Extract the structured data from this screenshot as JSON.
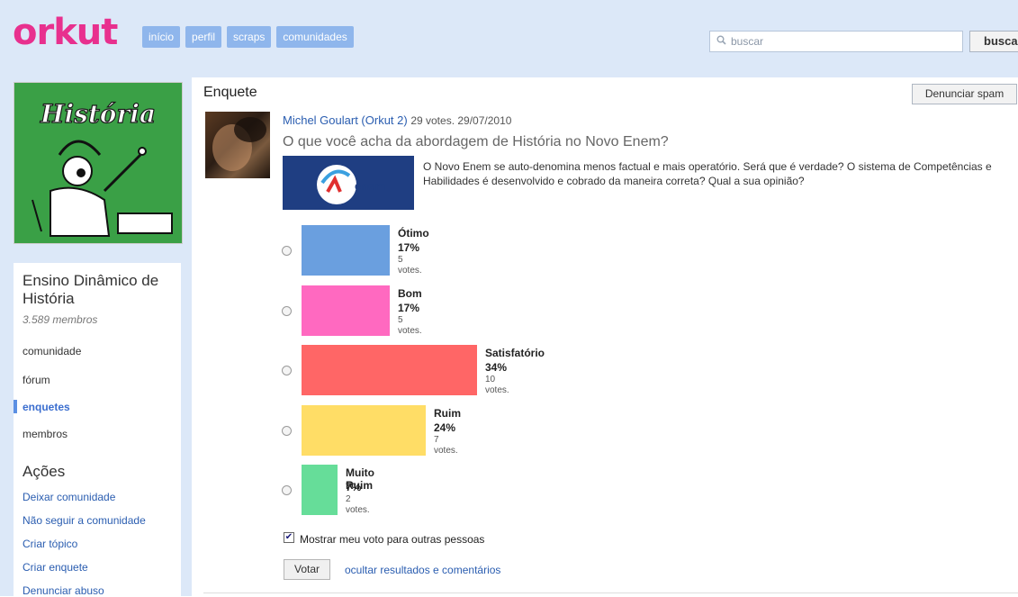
{
  "header": {
    "logo": "orkut",
    "nav": [
      "início",
      "perfil",
      "scraps",
      "comunidades"
    ],
    "search_placeholder": "buscar",
    "search_button": "buscar"
  },
  "sidebar": {
    "community_name": "Ensino Dinâmico de História",
    "members": "3.589 membros",
    "image_title": "História",
    "menu": [
      "comunidade",
      "fórum",
      "enquetes",
      "membros"
    ],
    "active_menu": "enquetes",
    "actions_title": "Ações",
    "actions": [
      "Deixar comunidade",
      "Não seguir a comunidade",
      "Criar tópico",
      "Criar enquete",
      "Denunciar abuso"
    ]
  },
  "poll": {
    "section_title": "Enquete",
    "spam_button": "Denunciar spam",
    "author": "Michel Goulart (Orkut 2)",
    "meta": "29 votes. 29/07/2010",
    "question": "O que você acha da abordagem de História no Novo Enem?",
    "image_label": "enem",
    "description": "O Novo Enem se auto-denomina menos factual e mais operatório. Será que é verdade? O sistema de Competências e Habilidades é desenvolvido e cobrado da maneira correta? Qual a sua opinião?",
    "options": [
      {
        "label": "Ótimo",
        "percent": "17%",
        "votes": "5 votes.",
        "value": 17,
        "color": "#6a9fdf"
      },
      {
        "label": "Bom",
        "percent": "17%",
        "votes": "5 votes.",
        "value": 17,
        "color": "#ff69c0"
      },
      {
        "label": "Satisfatório",
        "percent": "34%",
        "votes": "10 votes.",
        "value": 34,
        "color": "#ff6666"
      },
      {
        "label": "Ruim",
        "percent": "24%",
        "votes": "7 votes.",
        "value": 24,
        "color": "#ffdd66"
      },
      {
        "label": "Muito Ruim",
        "percent": "7%",
        "votes": "2 votes.",
        "value": 7,
        "color": "#66dd99"
      }
    ],
    "show_vote_label": "Mostrar meu voto para outras pessoas",
    "show_vote_checked": true,
    "vote_button": "Votar",
    "hide_results_link": "ocultar resultados e comentários"
  }
}
